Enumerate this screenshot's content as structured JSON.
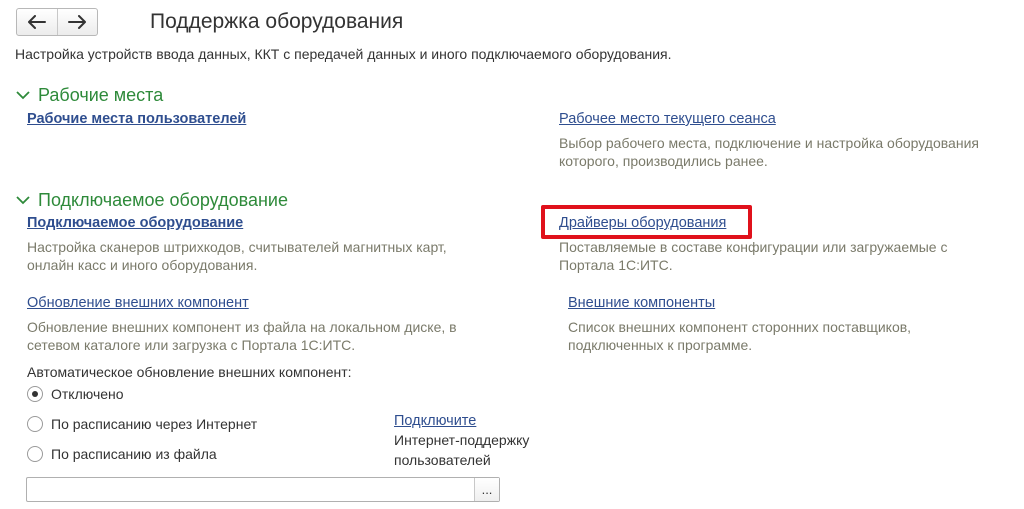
{
  "header": {
    "back_icon": "arrow-left-icon",
    "forward_icon": "arrow-right-icon",
    "title": "Поддержка оборудования",
    "subtitle": "Настройка устройств ввода данных, ККТ с передачей данных и иного подключаемого оборудования."
  },
  "workplaces": {
    "group_title": "Рабочие места",
    "user_workplaces_link": "Рабочие места пользователей",
    "current_session_link": "Рабочее место текущего сеанса",
    "current_session_desc": "Выбор рабочего места, подключение и настройка оборудования которого, производились ранее."
  },
  "equipment": {
    "group_title": "Подключаемое оборудование",
    "connected_link": "Подключаемое оборудование",
    "connected_desc": "Настройка сканеров штрихкодов, считывателей магнитных карт, онлайн касс и иного оборудования.",
    "drivers_link": "Драйверы оборудования",
    "drivers_desc": "Поставляемые в составе конфигурации или загружаемые с Портала 1С:ИТС.",
    "update_components_link": "Обновление внешних компонент",
    "update_components_desc": "Обновление внешних компонент из файла на локальном диске, в сетевом каталоге или загрузка с Портала 1С:ИТС.",
    "external_components_link": "Внешние компоненты",
    "external_components_desc": "Список внешних компонент сторонних поставщиков, подключенных к программе.",
    "auto_update_label": "Автоматическое обновление внешних компонент:",
    "options": [
      {
        "label": "Отключено",
        "checked": true
      },
      {
        "label": "По расписанию через Интернет",
        "checked": false
      },
      {
        "label": "По расписанию из файла",
        "checked": false
      }
    ],
    "connect_link": "Подключите",
    "connect_note": "Интернет-поддержку пользователей",
    "file_path_value": "",
    "browse_button": "..."
  },
  "colors": {
    "group_title": "#2e8a3a",
    "link": "#2f4e8f",
    "description": "#7a7a6a",
    "highlight": "#e0111b"
  }
}
